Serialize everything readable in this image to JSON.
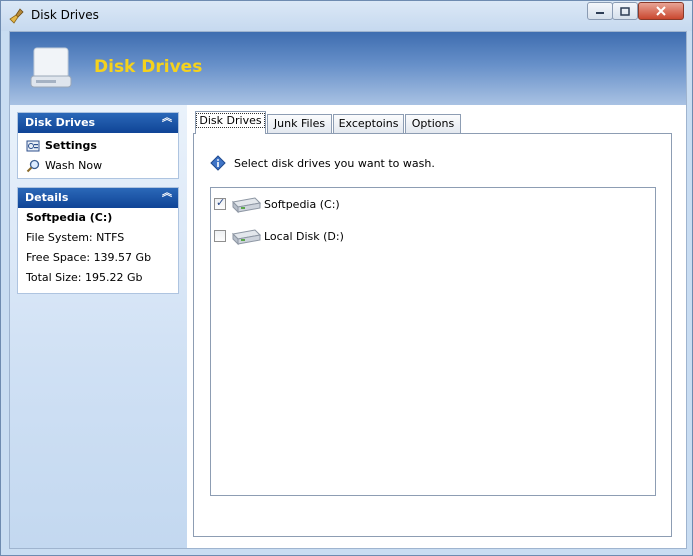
{
  "window": {
    "title": "Disk Drives"
  },
  "banner": {
    "title": "Disk Drives"
  },
  "sidebar": {
    "tasks_panel": {
      "header": "Disk Drives",
      "items": [
        {
          "label": "Settings",
          "icon": "settings-icon",
          "bold": true
        },
        {
          "label": "Wash Now",
          "icon": "magnifier-icon",
          "bold": false
        }
      ]
    },
    "details_panel": {
      "header": "Details",
      "drive_name": "Softpedia (C:)",
      "file_system": "File System: NTFS",
      "free_space": "Free Space: 139.57 Gb",
      "total_size": "Total Size: 195.22 Gb"
    }
  },
  "tabs": [
    "Disk Drives",
    "Junk Files",
    "Exceptoins",
    "Options"
  ],
  "active_tab": "Disk Drives",
  "disk_tab": {
    "instruction": "Select disk drives you want to wash.",
    "drives": [
      {
        "label": "Softpedia (C:)",
        "checked": true
      },
      {
        "label": "Local Disk (D:)",
        "checked": false
      }
    ]
  },
  "colors": {
    "banner_title": "#f5d21c",
    "panel_header": "#1a4fa0",
    "window_frame": "#c9ddf2"
  }
}
